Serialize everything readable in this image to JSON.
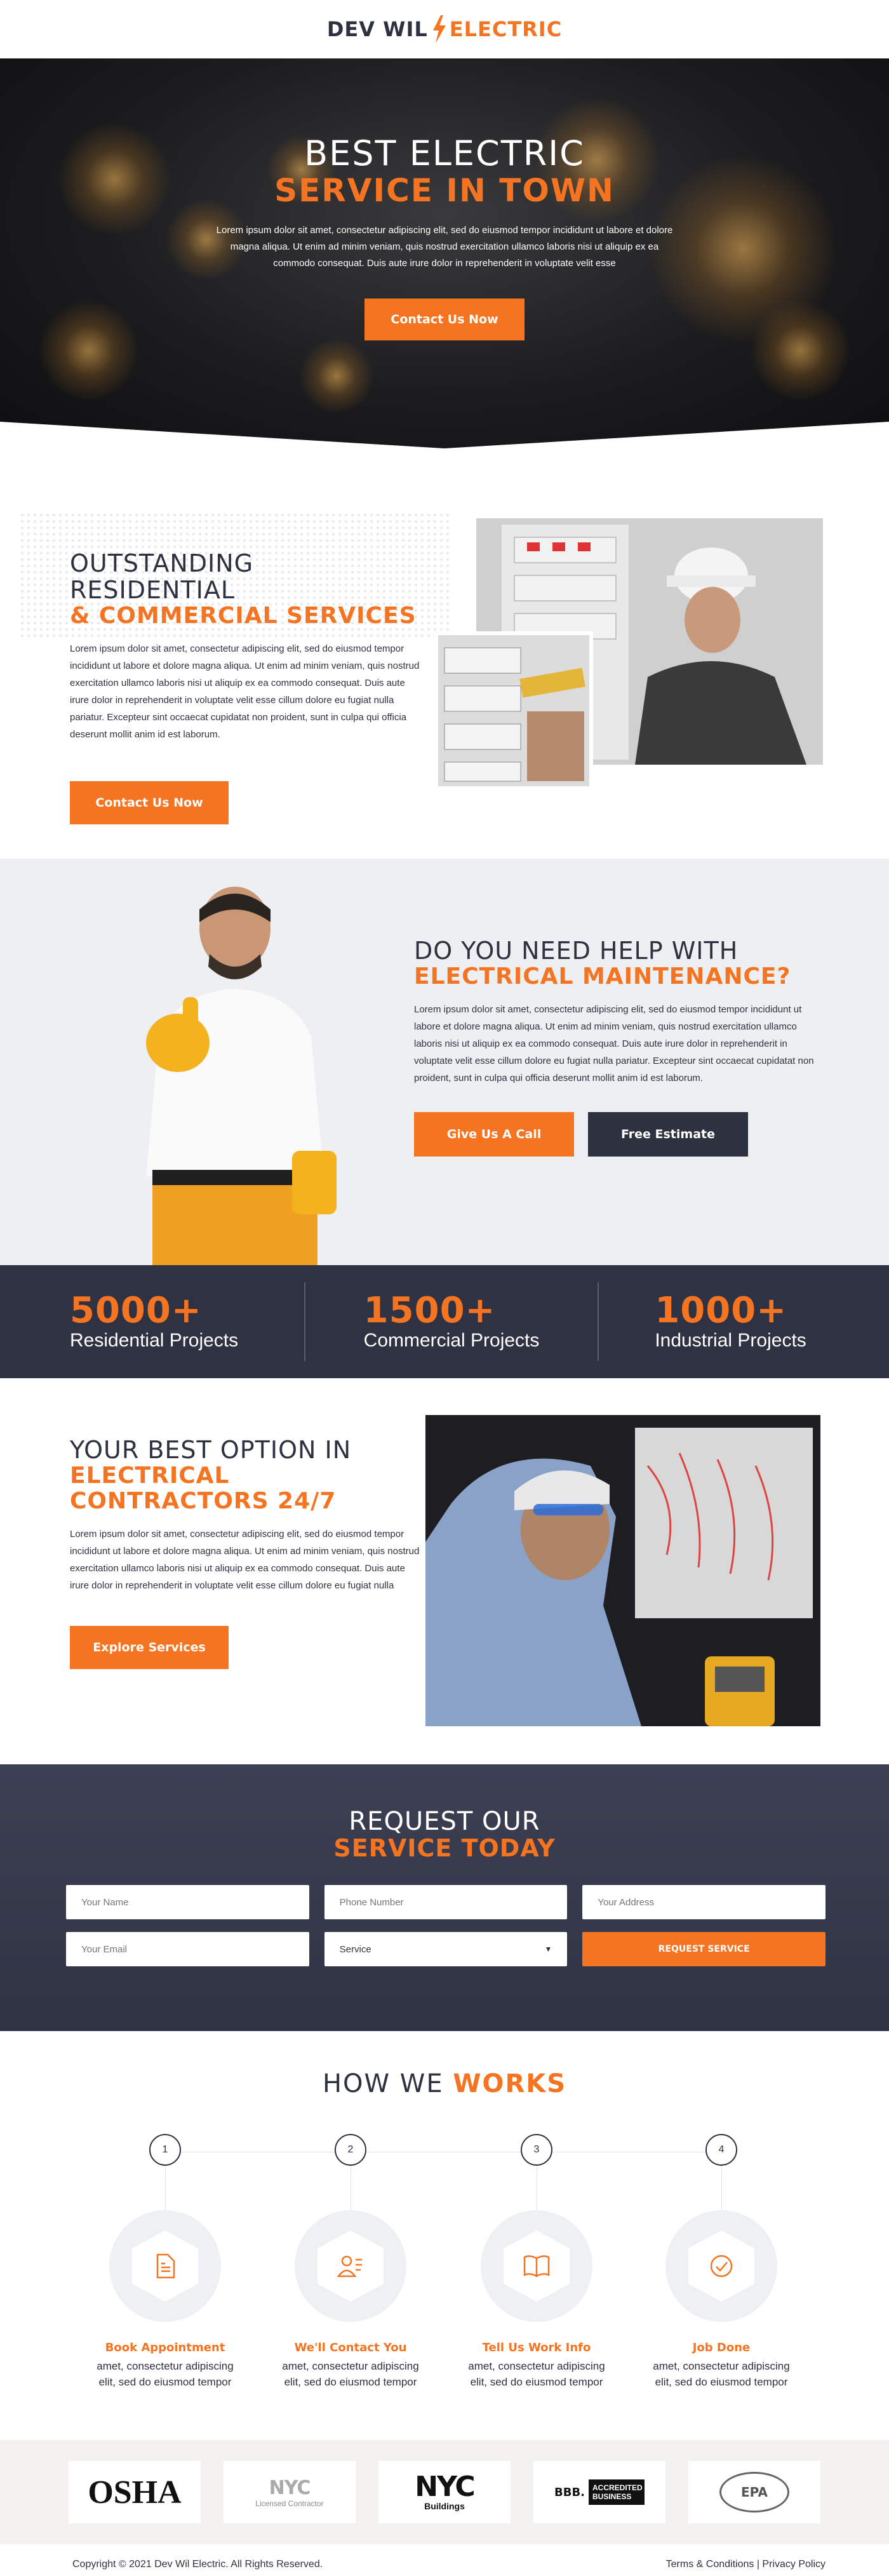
{
  "header": {
    "logo_left": "DEV WIL",
    "logo_right": "ELECTRIC"
  },
  "hero": {
    "title_line1": "BEST ELECTRIC",
    "title_line2": "SERVICE IN TOWN",
    "body": "Lorem ipsum dolor sit amet, consectetur adipiscing elit, sed do eiusmod tempor incididunt ut labore et dolore magna aliqua. Ut enim ad minim veniam, quis nostrud exercitation ullamco laboris nisi ut aliquip ex ea commodo consequat. Duis aute irure dolor in reprehenderit in voluptate velit esse",
    "button": "Contact Us Now"
  },
  "residential": {
    "title_line1": "OUTSTANDING RESIDENTIAL",
    "title_line2": "& COMMERCIAL SERVICES",
    "body": "Lorem ipsum dolor sit amet, consectetur adipiscing elit, sed do eiusmod tempor incididunt ut labore et dolore magna aliqua. Ut enim ad minim veniam, quis nostrud exercitation ullamco laboris nisi ut aliquip ex ea commodo consequat. Duis aute irure dolor in reprehenderit in voluptate velit esse cillum dolore eu fugiat nulla pariatur. Excepteur sint occaecat cupidatat non proident, sunt in culpa qui officia deserunt mollit anim id est laborum.",
    "button": "Contact Us Now"
  },
  "maintenance": {
    "title_line1": "DO YOU NEED HELP WITH",
    "title_line2": "ELECTRICAL MAINTENANCE?",
    "body": "Lorem ipsum dolor sit amet, consectetur adipiscing elit, sed do eiusmod tempor incididunt ut labore et dolore magna aliqua. Ut enim ad minim veniam, quis nostrud exercitation ullamco laboris nisi ut aliquip ex ea commodo consequat. Duis aute irure dolor in reprehenderit in voluptate velit esse cillum dolore eu fugiat nulla pariatur. Excepteur sint occaecat cupidatat non proident, sunt in culpa qui officia deserunt mollit anim id est laborum.",
    "button_call": "Give Us A Call",
    "button_estimate": "Free Estimate"
  },
  "stats": [
    {
      "number": "5000+",
      "label": "Residential Projects"
    },
    {
      "number": "1500+",
      "label": "Commercial Projects"
    },
    {
      "number": "1000+",
      "label": "Industrial Projects"
    }
  ],
  "contractors": {
    "title_line1": "YOUR BEST OPTION IN",
    "title_line2": "ELECTRICAL",
    "title_line3": "CONTRACTORS 24/7",
    "body": "Lorem ipsum dolor sit amet, consectetur adipiscing elit, sed do eiusmod tempor incididunt ut labore et dolore magna aliqua. Ut enim ad minim veniam, quis nostrud exercitation ullamco laboris nisi ut aliquip ex ea commodo consequat. Duis aute irure dolor in reprehenderit in voluptate velit esse cillum dolore eu fugiat nulla",
    "button": "Explore Services"
  },
  "request": {
    "title_line1": "REQUEST OUR",
    "title_line2": "SERVICE TODAY",
    "name_placeholder": "Your Name",
    "phone_placeholder": "Phone Number",
    "address_placeholder": "Your Address",
    "email_placeholder": "Your Email",
    "service_selected": "Service",
    "submit": "REQUEST SERVICE"
  },
  "how": {
    "title_light": "HOW WE",
    "title_bold": "WORKS",
    "steps": [
      {
        "num": "1",
        "title": "Book Appointment",
        "desc": "amet, consectetur adipiscing elit, sed do eiusmod tempor"
      },
      {
        "num": "2",
        "title": "We'll Contact You",
        "desc": "amet, consectetur adipiscing elit, sed do eiusmod tempor"
      },
      {
        "num": "3",
        "title": "Tell Us Work Info",
        "desc": "amet, consectetur adipiscing elit, sed do eiusmod tempor"
      },
      {
        "num": "4",
        "title": "Job Done",
        "desc": "amet, consectetur adipiscing elit, sed do eiusmod tempor"
      }
    ]
  },
  "logos": {
    "osha": "OSHA",
    "nyc1": "NYC",
    "nyc1_sub": "Licensed Contractor",
    "nyc2": "NYC",
    "nyc2_sub": "Buildings",
    "bbb": "ACCREDITED BUSINESS",
    "bbb_mark": "BBB.",
    "epa": "EPA"
  },
  "footer": {
    "copyright": "Copyright © 2021 Dev Wil Electric. All Rights Reserved.",
    "links": "Terms & Conditions | Privacy Policy"
  },
  "colors": {
    "accent": "#f47421",
    "dark": "#2e3240",
    "light_bg": "#edeff2"
  }
}
